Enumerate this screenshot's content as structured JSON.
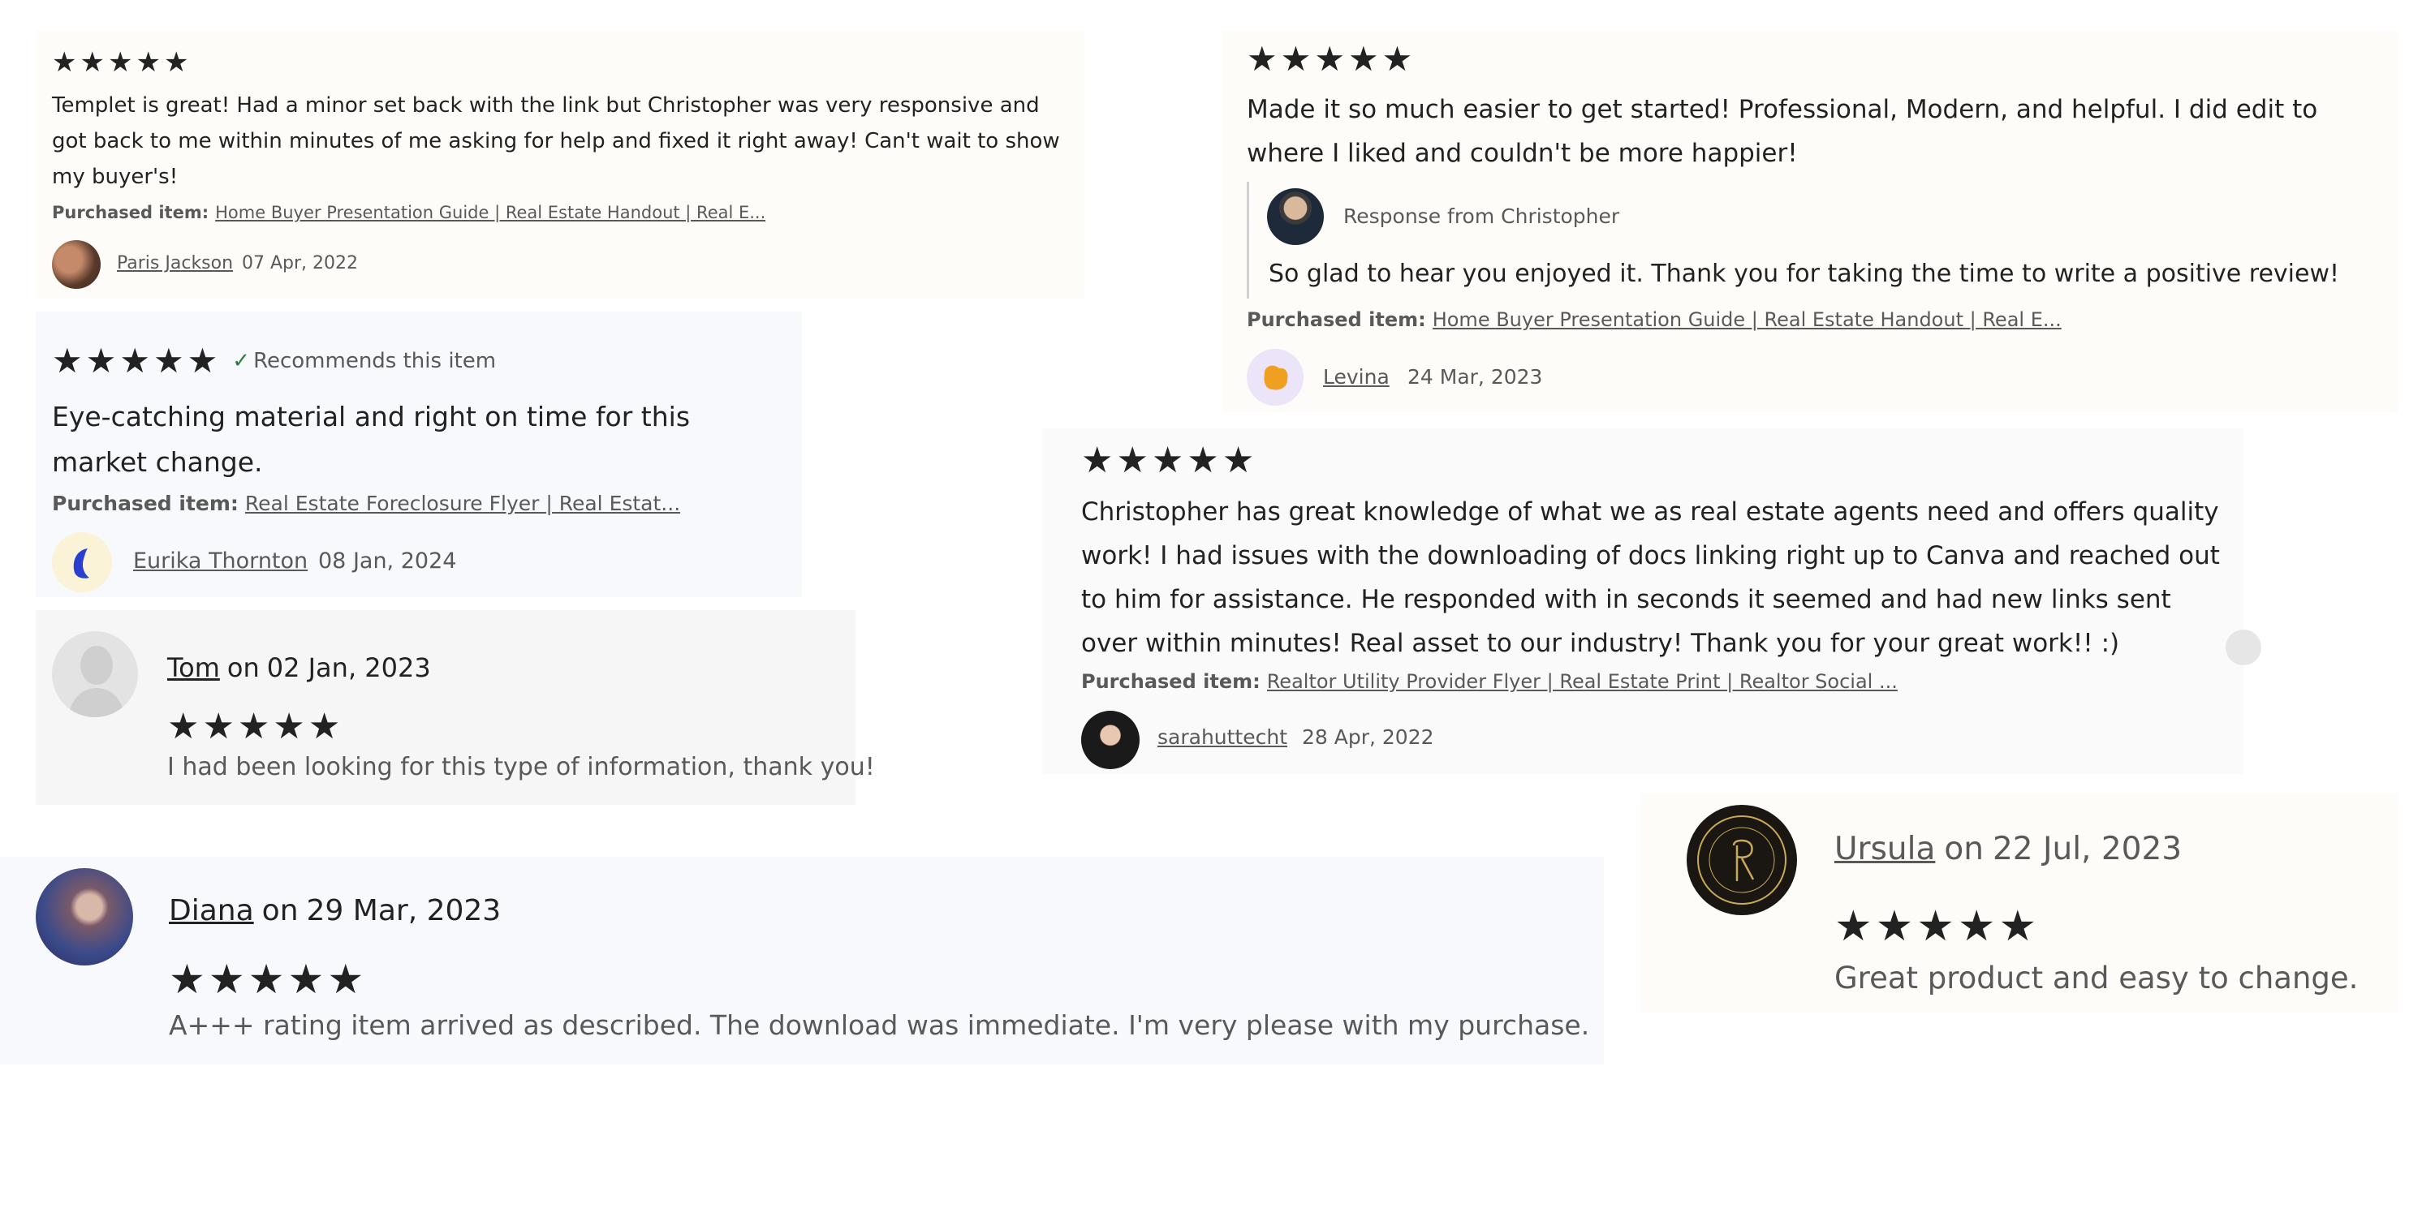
{
  "colors": {
    "card_cream": "#fdfcf8",
    "card_blue": "#f8f9fc",
    "card_gray": "#f6f6f6",
    "star": "#222222",
    "text": "#222222",
    "muted": "#595959",
    "check_green": "#2f7a3e"
  },
  "reviews": [
    {
      "id": "r1",
      "rating": 5,
      "text": "Templet is great! Had a minor set back with the link but Christopher was very responsive and got back to me within minutes of me asking for help and fixed it right away! Can't wait to show my buyer's!",
      "purchased_label": "Purchased item:",
      "purchased_item": "Home Buyer Presentation Guide | Real Estate Handout | Real E...",
      "reviewer": "Paris Jackson",
      "date": "07 Apr, 2022",
      "avatar_icon": "person-photo-icon"
    },
    {
      "id": "r2",
      "rating": 5,
      "text": "Made it so much easier to get started! Professional, Modern, and helpful. I did edit to where I liked and couldn't be more happier!",
      "response_from": "Response from Christopher",
      "response_text": "So glad to hear you enjoyed it. Thank you for taking the time to write a positive review!",
      "purchased_label": "Purchased item:",
      "purchased_item": "Home Buyer Presentation Guide | Real Estate Handout | Real E...",
      "reviewer": "Levina",
      "date": "24 Mar, 2023",
      "avatar_icon": "orange-blob-icon"
    },
    {
      "id": "r3",
      "rating": 5,
      "recommends": "Recommends this item",
      "text": "Eye-catching material and right on time for this market change.",
      "purchased_label": "Purchased item:",
      "purchased_item": "Real Estate Foreclosure Flyer | Real Estat...",
      "reviewer": "Eurika Thornton",
      "date": "08 Jan, 2024",
      "avatar_icon": "blue-crescent-icon"
    },
    {
      "id": "r4",
      "rating": 5,
      "text": "Christopher has great knowledge of what we as real estate agents need and offers quality work! I had issues with the downloading of docs linking right up to Canva and reached out to him for assistance. He responded with in seconds it seemed and had new links sent over within minutes! Real asset to our industry! Thank you for your great work!! :)",
      "purchased_label": "Purchased item:",
      "purchased_item": "Realtor Utility Provider Flyer | Real Estate Print | Realtor Social ...",
      "reviewer": "sarahuttecht",
      "date": "28 Apr, 2022",
      "avatar_icon": "person-photo-icon"
    },
    {
      "id": "r5",
      "rating": 5,
      "reviewer": "Tom",
      "on": "on",
      "date": "02 Jan, 2023",
      "text": "I had been looking for this type of information, thank you!",
      "avatar_icon": "default-avatar-icon"
    },
    {
      "id": "r6",
      "rating": 5,
      "reviewer": "Diana",
      "on": "on",
      "date": "29 Mar, 2023",
      "text": "A+++ rating item arrived as described. The download was immediate. I'm very please with my purchase.",
      "avatar_icon": "person-photo-icon"
    },
    {
      "id": "r7",
      "rating": 5,
      "reviewer": "Ursula",
      "on": "on",
      "date": "22 Jul, 2023",
      "text": "Great product and easy to change.",
      "avatar_icon": "monogram-logo-icon"
    }
  ]
}
